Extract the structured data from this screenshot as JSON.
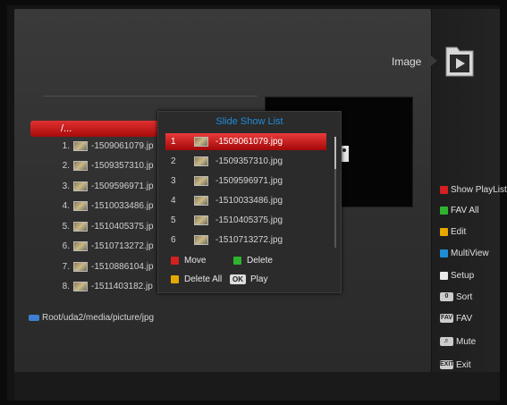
{
  "header": {
    "title": "Image"
  },
  "colors": {
    "red": "#d42020",
    "green": "#2fb32f",
    "yellow": "#e6a800",
    "blue": "#1f8cd8",
    "white": "#e8e8e8"
  },
  "browser": {
    "parent": "/...",
    "files": [
      {
        "num": "1.",
        "name": "-1509061079.jp"
      },
      {
        "num": "2.",
        "name": "-1509357310.jp"
      },
      {
        "num": "3.",
        "name": "-1509596971.jp"
      },
      {
        "num": "4.",
        "name": "-1510033486.jp"
      },
      {
        "num": "5.",
        "name": "-1510405375.jp"
      },
      {
        "num": "6.",
        "name": "-1510713272.jp"
      },
      {
        "num": "7.",
        "name": "-1510886104.jp"
      },
      {
        "num": "8.",
        "name": "-1511403182.jp"
      }
    ],
    "path": "Root/uda2/media/picture/jpg"
  },
  "popup": {
    "title": "Slide Show List",
    "items": [
      {
        "index": "1",
        "name": "-1509061079.jpg",
        "selected": true
      },
      {
        "index": "2",
        "name": "-1509357310.jpg"
      },
      {
        "index": "3",
        "name": "-1509596971.jpg"
      },
      {
        "index": "4",
        "name": "-1510033486.jpg"
      },
      {
        "index": "5",
        "name": "-1510405375.jpg"
      },
      {
        "index": "6",
        "name": "-1510713272.jpg"
      }
    ],
    "actions": {
      "move": "Move",
      "delete": "Delete",
      "delete_all": "Delete All",
      "ok_key": "OK",
      "play": "Play"
    }
  },
  "legend": {
    "show_playlist": "Show PlayList",
    "fav_all": "FAV All",
    "edit": "Edit",
    "multiview": "MultiView",
    "setup": "Setup",
    "sort": "Sort",
    "fav": "FAV",
    "mute": "Mute",
    "exit": "Exit",
    "fav_key": "FAV",
    "exit_key": "EXIT"
  }
}
